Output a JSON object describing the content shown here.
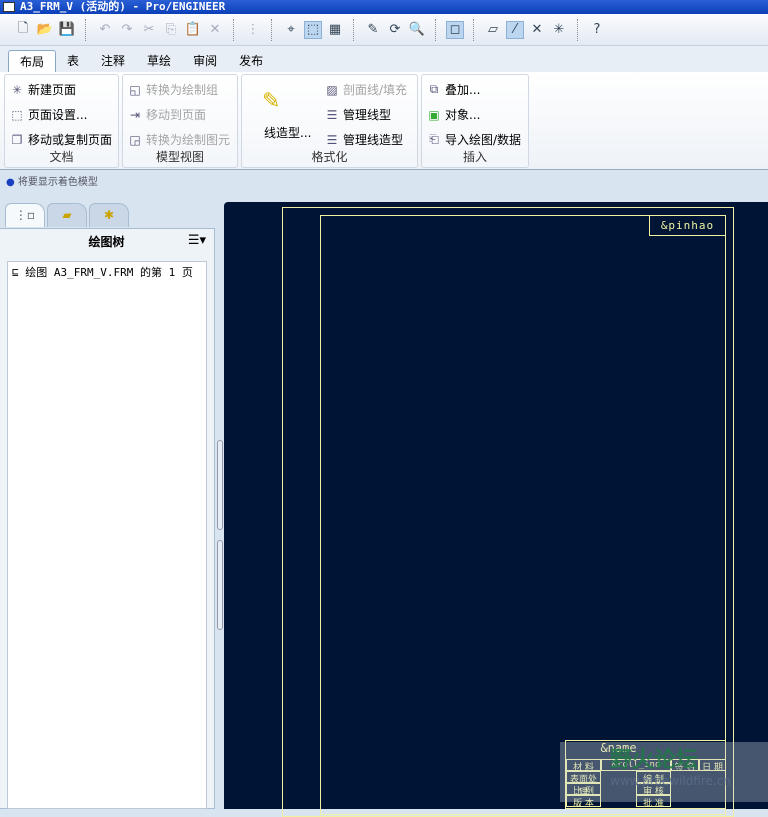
{
  "window": {
    "title": "A3_FRM_V (活动的) - Pro/ENGINEER"
  },
  "tabs": [
    "布局",
    "表",
    "注释",
    "草绘",
    "审阅",
    "发布"
  ],
  "ribbon": {
    "doc": {
      "label": "文档",
      "items": [
        "新建页面",
        "页面设置...",
        "移动或复制页面"
      ]
    },
    "model_view": {
      "label": "模型视图",
      "items": [
        "转换为绘制组",
        "移动到页面",
        "转换为绘制图元"
      ]
    },
    "format": {
      "label": "格式化",
      "big": "线造型...",
      "items": [
        "剖面线/填充",
        "管理线型",
        "管理线造型"
      ]
    },
    "insert": {
      "label": "插入",
      "items": [
        "叠加...",
        "对象...",
        "导入绘图/数据"
      ]
    }
  },
  "status": "将要显示着色模型",
  "panel": {
    "title": "绘图树",
    "tree": [
      "绘图 A3_FRM_V.FRM 的第 1 页"
    ]
  },
  "drawing": {
    "pinhao": "&pinhao",
    "name": "&name",
    "material_value": "&roll_ind",
    "cells": [
      "材 料",
      "签 名",
      "日 期",
      "表面处理",
      "编 制",
      "比 例",
      "审 核",
      "版 本",
      "批 准"
    ]
  },
  "watermark": {
    "text": "野火论坛",
    "url": "www.proewildfire.cn"
  }
}
